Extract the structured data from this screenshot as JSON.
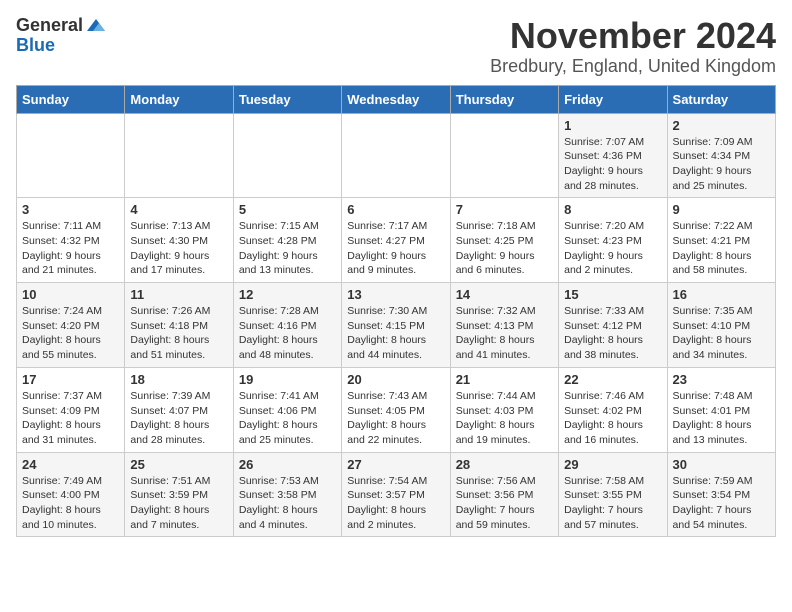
{
  "logo": {
    "general": "General",
    "blue": "Blue"
  },
  "title": "November 2024",
  "subtitle": "Bredbury, England, United Kingdom",
  "days_of_week": [
    "Sunday",
    "Monday",
    "Tuesday",
    "Wednesday",
    "Thursday",
    "Friday",
    "Saturday"
  ],
  "weeks": [
    [
      {
        "day": "",
        "info": ""
      },
      {
        "day": "",
        "info": ""
      },
      {
        "day": "",
        "info": ""
      },
      {
        "day": "",
        "info": ""
      },
      {
        "day": "",
        "info": ""
      },
      {
        "day": "1",
        "info": "Sunrise: 7:07 AM\nSunset: 4:36 PM\nDaylight: 9 hours and 28 minutes."
      },
      {
        "day": "2",
        "info": "Sunrise: 7:09 AM\nSunset: 4:34 PM\nDaylight: 9 hours and 25 minutes."
      }
    ],
    [
      {
        "day": "3",
        "info": "Sunrise: 7:11 AM\nSunset: 4:32 PM\nDaylight: 9 hours and 21 minutes."
      },
      {
        "day": "4",
        "info": "Sunrise: 7:13 AM\nSunset: 4:30 PM\nDaylight: 9 hours and 17 minutes."
      },
      {
        "day": "5",
        "info": "Sunrise: 7:15 AM\nSunset: 4:28 PM\nDaylight: 9 hours and 13 minutes."
      },
      {
        "day": "6",
        "info": "Sunrise: 7:17 AM\nSunset: 4:27 PM\nDaylight: 9 hours and 9 minutes."
      },
      {
        "day": "7",
        "info": "Sunrise: 7:18 AM\nSunset: 4:25 PM\nDaylight: 9 hours and 6 minutes."
      },
      {
        "day": "8",
        "info": "Sunrise: 7:20 AM\nSunset: 4:23 PM\nDaylight: 9 hours and 2 minutes."
      },
      {
        "day": "9",
        "info": "Sunrise: 7:22 AM\nSunset: 4:21 PM\nDaylight: 8 hours and 58 minutes."
      }
    ],
    [
      {
        "day": "10",
        "info": "Sunrise: 7:24 AM\nSunset: 4:20 PM\nDaylight: 8 hours and 55 minutes."
      },
      {
        "day": "11",
        "info": "Sunrise: 7:26 AM\nSunset: 4:18 PM\nDaylight: 8 hours and 51 minutes."
      },
      {
        "day": "12",
        "info": "Sunrise: 7:28 AM\nSunset: 4:16 PM\nDaylight: 8 hours and 48 minutes."
      },
      {
        "day": "13",
        "info": "Sunrise: 7:30 AM\nSunset: 4:15 PM\nDaylight: 8 hours and 44 minutes."
      },
      {
        "day": "14",
        "info": "Sunrise: 7:32 AM\nSunset: 4:13 PM\nDaylight: 8 hours and 41 minutes."
      },
      {
        "day": "15",
        "info": "Sunrise: 7:33 AM\nSunset: 4:12 PM\nDaylight: 8 hours and 38 minutes."
      },
      {
        "day": "16",
        "info": "Sunrise: 7:35 AM\nSunset: 4:10 PM\nDaylight: 8 hours and 34 minutes."
      }
    ],
    [
      {
        "day": "17",
        "info": "Sunrise: 7:37 AM\nSunset: 4:09 PM\nDaylight: 8 hours and 31 minutes."
      },
      {
        "day": "18",
        "info": "Sunrise: 7:39 AM\nSunset: 4:07 PM\nDaylight: 8 hours and 28 minutes."
      },
      {
        "day": "19",
        "info": "Sunrise: 7:41 AM\nSunset: 4:06 PM\nDaylight: 8 hours and 25 minutes."
      },
      {
        "day": "20",
        "info": "Sunrise: 7:43 AM\nSunset: 4:05 PM\nDaylight: 8 hours and 22 minutes."
      },
      {
        "day": "21",
        "info": "Sunrise: 7:44 AM\nSunset: 4:03 PM\nDaylight: 8 hours and 19 minutes."
      },
      {
        "day": "22",
        "info": "Sunrise: 7:46 AM\nSunset: 4:02 PM\nDaylight: 8 hours and 16 minutes."
      },
      {
        "day": "23",
        "info": "Sunrise: 7:48 AM\nSunset: 4:01 PM\nDaylight: 8 hours and 13 minutes."
      }
    ],
    [
      {
        "day": "24",
        "info": "Sunrise: 7:49 AM\nSunset: 4:00 PM\nDaylight: 8 hours and 10 minutes."
      },
      {
        "day": "25",
        "info": "Sunrise: 7:51 AM\nSunset: 3:59 PM\nDaylight: 8 hours and 7 minutes."
      },
      {
        "day": "26",
        "info": "Sunrise: 7:53 AM\nSunset: 3:58 PM\nDaylight: 8 hours and 4 minutes."
      },
      {
        "day": "27",
        "info": "Sunrise: 7:54 AM\nSunset: 3:57 PM\nDaylight: 8 hours and 2 minutes."
      },
      {
        "day": "28",
        "info": "Sunrise: 7:56 AM\nSunset: 3:56 PM\nDaylight: 7 hours and 59 minutes."
      },
      {
        "day": "29",
        "info": "Sunrise: 7:58 AM\nSunset: 3:55 PM\nDaylight: 7 hours and 57 minutes."
      },
      {
        "day": "30",
        "info": "Sunrise: 7:59 AM\nSunset: 3:54 PM\nDaylight: 7 hours and 54 minutes."
      }
    ]
  ]
}
